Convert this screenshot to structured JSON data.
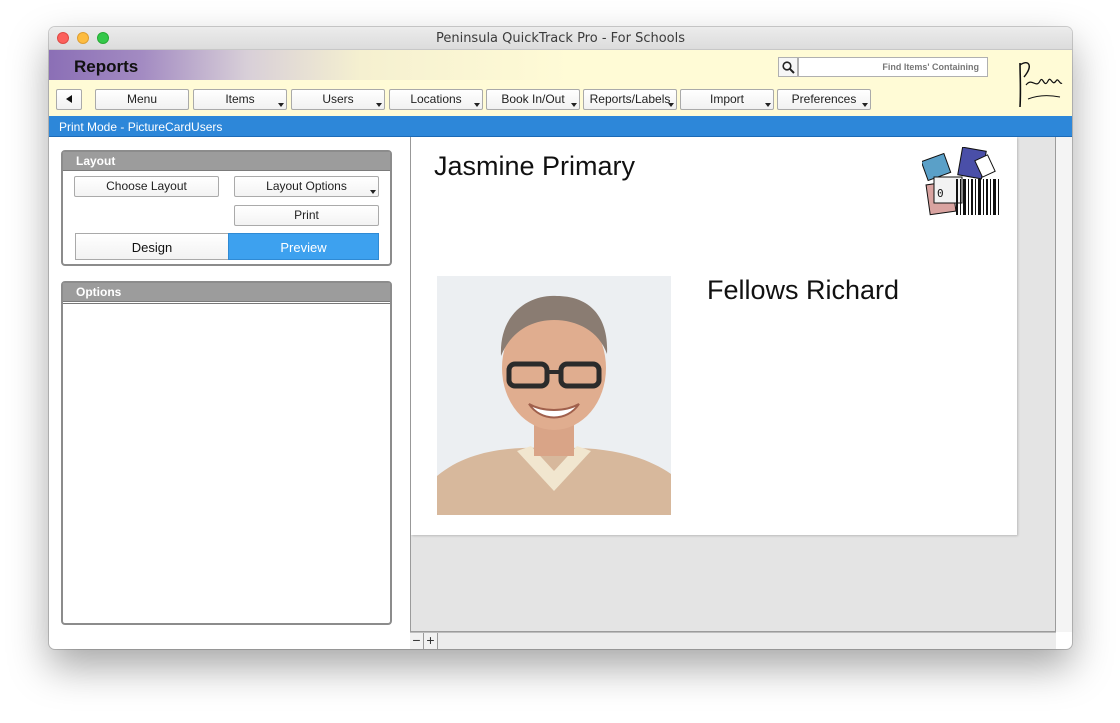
{
  "window": {
    "title": "Peninsula QuickTrack Pro - For Schools"
  },
  "header": {
    "section_title": "Reports",
    "search": {
      "placeholder": "Find Items' Containing",
      "value": ""
    },
    "logo_text": "Peninsula"
  },
  "toolbar": {
    "back_icon": "left-triangle-icon",
    "buttons": [
      {
        "label": "Menu",
        "has_dropdown": false
      },
      {
        "label": "Items",
        "has_dropdown": true
      },
      {
        "label": "Users",
        "has_dropdown": true
      },
      {
        "label": "Locations",
        "has_dropdown": true
      },
      {
        "label": "Book In/Out",
        "has_dropdown": true
      },
      {
        "label": "Reports/Labels",
        "has_dropdown": true
      },
      {
        "label": "Import",
        "has_dropdown": true
      },
      {
        "label": "Preferences",
        "has_dropdown": true
      }
    ]
  },
  "modebar": {
    "text": "Print Mode - PictureCardUsers"
  },
  "layout_panel": {
    "title": "Layout",
    "choose_layout": "Choose Layout",
    "layout_options": "Layout Options",
    "print": "Print",
    "design_tab": "Design",
    "preview_tab": "Preview",
    "active_tab": "Preview"
  },
  "options_panel": {
    "title": "Options"
  },
  "card": {
    "school": "Jasmine Primary",
    "user_name": "Fellows Richard"
  },
  "zoom": {
    "minus": "−",
    "plus": "+"
  },
  "colors": {
    "accent_blue": "#2d87d9",
    "preview_tab": "#3da1ef",
    "header_yellow": "#fffbd6",
    "header_purple": "#8b6fb6"
  }
}
